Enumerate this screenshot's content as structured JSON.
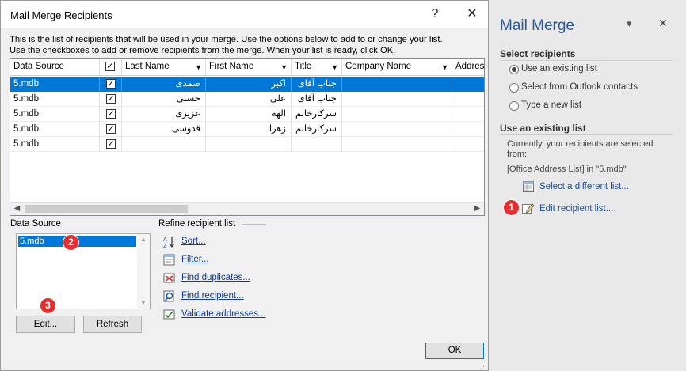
{
  "dialog": {
    "title": "Mail Merge Recipients",
    "help_glyph": "?",
    "close_glyph": "✕",
    "intro_line1": "This is the list of recipients that will be used in your merge.  Use the options below to add to or change your list.",
    "intro_line2": "Use the checkboxes to add or remove recipients from the merge.  When your list is ready, click OK.",
    "columns": [
      "Data Source",
      "",
      "Last Name",
      "First Name",
      "Title",
      "Company Name",
      "Address"
    ],
    "rows": [
      {
        "source": "5.mdb",
        "checked": "✓",
        "last": "صمدی",
        "first": "اکبر",
        "title": "جناب آقای",
        "selected": true
      },
      {
        "source": "5.mdb",
        "checked": "✓",
        "last": "حسنی",
        "first": "علی",
        "title": "جناب آقای",
        "selected": false
      },
      {
        "source": "5.mdb",
        "checked": "✓",
        "last": "عزیزی",
        "first": "الهه",
        "title": "سرکارخانم",
        "selected": false
      },
      {
        "source": "5.mdb",
        "checked": "✓",
        "last": "قدوسی",
        "first": "زهرا",
        "title": "سرکارخانم",
        "selected": false
      },
      {
        "source": "5.mdb",
        "checked": "✓",
        "last": "",
        "first": "",
        "title": "",
        "selected": false
      }
    ],
    "data_source_label": "Data Source",
    "data_source_item": "5.mdb",
    "edit_label": "Edit...",
    "refresh_label": "Refresh",
    "refine_label": "Refine recipient list",
    "refine_links": [
      {
        "label": "Sort...",
        "icon": "sort-az-icon"
      },
      {
        "label": "Filter...",
        "icon": "filter-icon"
      },
      {
        "label": "Find duplicates...",
        "icon": "find-duplicates-icon"
      },
      {
        "label": "Find recipient...",
        "icon": "find-recipient-icon"
      },
      {
        "label": "Validate addresses...",
        "icon": "validate-addresses-icon"
      }
    ],
    "ok_label": "OK"
  },
  "badges": [
    "1",
    "2",
    "3"
  ],
  "pane": {
    "title": "Mail Merge",
    "dropdown_glyph": "▾",
    "close_glyph": "✕",
    "select_recipients_heading": "Select recipients",
    "options": [
      {
        "label": "Use an existing list",
        "selected": true
      },
      {
        "label": "Select from Outlook contacts",
        "selected": false
      },
      {
        "label": "Type a new list",
        "selected": false
      }
    ],
    "existing_list_heading": "Use an existing list",
    "status_line1": "Currently, your recipients are selected",
    "status_line2": "from:",
    "source_text": "[Office Address List] in \"5.mdb\"",
    "select_different_label": "Select a different list...",
    "edit_recipient_label": "Edit recipient list..."
  },
  "colors": {
    "selection": "#0078d7",
    "badge": "#e32f2f",
    "pane_title": "#2b5797",
    "link": "#0d3c9c"
  }
}
